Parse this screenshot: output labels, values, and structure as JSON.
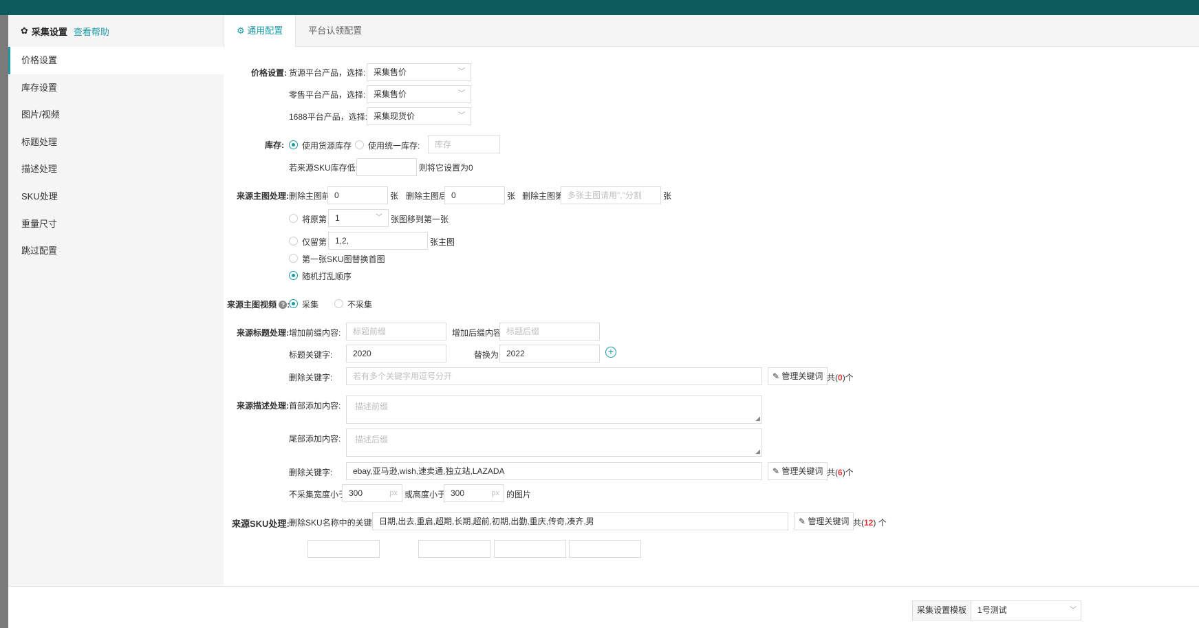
{
  "sidebar": {
    "title": "采集设置",
    "help": "查看帮助",
    "items": [
      "价格设置",
      "库存设置",
      "图片/视频",
      "标题处理",
      "描述处理",
      "SKU处理",
      "重量尺寸",
      "跳过配置"
    ]
  },
  "tabs": [
    "通用配置",
    "平台认领配置"
  ],
  "price": {
    "label": "价格设置:",
    "rows": [
      {
        "label": "货源平台产品，选择:",
        "value": "采集售价"
      },
      {
        "label": "零售平台产品，选择:",
        "value": "采集售价"
      },
      {
        "label": "1688平台产品，选择:",
        "value": "采集现货价"
      }
    ]
  },
  "stock": {
    "label": "库存:",
    "option_source": "使用货源库存",
    "option_unified": "使用统一库存:",
    "unified_placeholder": "库存",
    "low_prefix": "若来源SKU库存低于",
    "low_suffix": "则将它设置为0"
  },
  "main_image": {
    "label": "来源主图处理:",
    "del_front": "删除主图前",
    "del_front_value": "0",
    "del_back": "删除主图后",
    "del_back_value": "0",
    "del_nth": "删除主图第",
    "del_nth_placeholder": "多张主图请用\",\"分割",
    "unit": "张",
    "move_prefix": "将原第",
    "move_value": "1",
    "move_suffix": "张图移到第一张",
    "keep_prefix": "仅留第",
    "keep_value": "1,2,",
    "keep_suffix": "张主图",
    "first_sku": "第一张SKU图替换首图",
    "shuffle": "随机打乱顺序"
  },
  "main_video": {
    "label": "来源主图视频",
    "hint": "?",
    "colon": ":",
    "collect": "采集",
    "no_collect": "不采集"
  },
  "title": {
    "label": "来源标题处理:",
    "prefix_label": "增加前缀内容:",
    "prefix_placeholder": "标题前缀",
    "suffix_label": "增加后缀内容:",
    "suffix_placeholder": "标题后缀",
    "keyword_label": "标题关键字:",
    "keyword_value": "2020",
    "replace_label": "替换为:",
    "replace_value": "2022",
    "delete_label": "删除关键字:",
    "delete_placeholder": "若有多个关键字用逗号分开",
    "manage": "管理关键词",
    "count_prefix": "共(",
    "count": "0",
    "count_suffix": ")个"
  },
  "desc": {
    "label": "来源描述处理:",
    "head_label": "首部添加内容:",
    "head_placeholder": "描述前缀",
    "tail_label": "尾部添加内容:",
    "tail_placeholder": "描述后缀",
    "delete_label": "删除关键字:",
    "delete_value": "ebay,亚马逊,wish,速卖通,独立站,LAZADA",
    "manage": "管理关键词",
    "count_prefix": "共(",
    "count": "6",
    "count_suffix": ")个",
    "width_prefix": "不采集宽度小于",
    "width_value": "300",
    "px": "px",
    "height_prefix": "或高度小于",
    "height_value": "300",
    "img_suffix": "的图片"
  },
  "sku": {
    "label": "来源SKU处理:",
    "del_label": "删除SKU名称中的关键字:",
    "del_value": "日期,出去,重启,超期,长期,超前,初期,出勤,重庆,传奇,凑齐,男",
    "manage": "管理关键词",
    "count_prefix": "共(",
    "count": "12",
    "count_suffix": ") 个"
  },
  "footer": {
    "template_label": "采集设置模板",
    "template_value": "1号测试"
  },
  "colors": {
    "accent": "#1a9aa6",
    "danger": "#e03535",
    "topbar": "#0d5b5c"
  }
}
